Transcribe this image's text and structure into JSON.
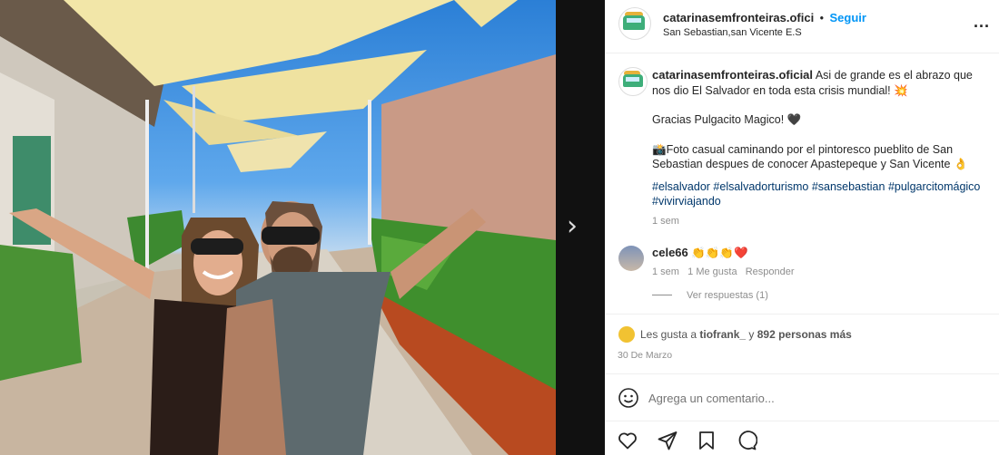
{
  "post": {
    "username": "catarinasemfronteiras.ofici",
    "dot": "•",
    "follow_label": "Seguir",
    "location": "San Sebastian,san Vicente E.S",
    "more_label": "..."
  },
  "caption": {
    "username": "catarinasemfronteiras.oficial",
    "line1": " Asi de grande es el abrazo que nos dio El Salvador en toda esta crisis mundial! 💥",
    "line2": "Gracias Pulgacito Magico! 🖤",
    "line3": "📸Foto casual caminando por el pintoresco pueblito de San Sebastian despues de conocer Apastepeque y San Vicente 👌",
    "hashtags": [
      "#elsalvador",
      "#elsalvadorturismo",
      "#sansebastian",
      "#pulgarcitomágico",
      "#vivirviajando"
    ],
    "time": "1 sem"
  },
  "comment": {
    "username": "cele66",
    "text": "👏👏👏❤️",
    "time": "1 sem",
    "likes": "1 Me gusta",
    "reply": "Responder",
    "view_replies": "Ver respuestas (1)"
  },
  "likes": {
    "prefix": "Les gusta a ",
    "user": "tiofrank_",
    "middle": " y ",
    "others": "892 personas más",
    "date": "30 De Marzo"
  },
  "add_comment": {
    "placeholder": "Agrega un comentario..."
  },
  "icons": {
    "like": "heart-icon",
    "comment": "comment-icon",
    "share": "paper-plane-icon",
    "save": "bookmark-icon",
    "emoji": "emoji-icon",
    "next": "chevron-right-icon"
  },
  "colors": {
    "link_blue": "#0095f6",
    "hashtag": "#00376b",
    "muted": "#8e8e8e"
  }
}
